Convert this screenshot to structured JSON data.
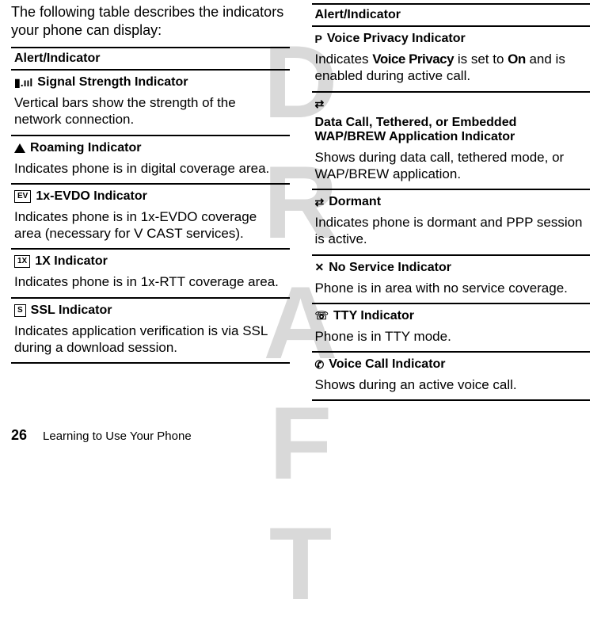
{
  "watermark": "DRAFT",
  "intro": "The following table describes the indicators your phone can display:",
  "header": "Alert/Indicator",
  "left_rows": [
    {
      "icon": "signal-bars-icon",
      "icon_text": "▮.ııl",
      "title": "Signal Strength Indicator",
      "desc": "Vertical bars show the strength of the network connection."
    },
    {
      "icon": "triangle-icon",
      "icon_text": "",
      "title": "Roaming Indicator",
      "desc": "Indicates phone is in digital coverage area."
    },
    {
      "icon": "ev-box-icon",
      "icon_text": "EV",
      "title": "1x-EVDO Indicator",
      "desc": "Indicates phone is in 1x-EVDO coverage area (necessary for V CAST services)."
    },
    {
      "icon": "1x-box-icon",
      "icon_text": "1X",
      "title": "1X Indicator",
      "desc": "Indicates phone is in 1x-RTT coverage area."
    },
    {
      "icon": "ssl-box-icon",
      "icon_text": "S",
      "title": "SSL Indicator",
      "desc_pre": "Indicates ",
      "desc_bold": "application verification is via SSL during a download session.",
      "desc_post": ""
    }
  ],
  "right_rows": [
    {
      "icon": "p-icon",
      "icon_text": "P",
      "title": "Voice Privacy Indicator",
      "desc_pre": "Indicates ",
      "cond1": "Voice Privacy",
      "mid1": " is set to ",
      "cond2": "On",
      "mid2": " and is enabled during active call."
    },
    {
      "icon": "data-arrows-icon",
      "icon_text": "⇄",
      "title": "Data Call, Tethered, or Embedded WAP/BREW Application Indicator",
      "desc": "Shows during data call, tethered mode, or WAP/BREW application."
    },
    {
      "icon": "dormant-icon",
      "icon_text": "⇄",
      "title": "Dormant",
      "desc_pre": "Indicates ",
      "desc_bold": "phone is dormant and PPP session is active.",
      "desc_post": ""
    },
    {
      "icon": "no-service-icon",
      "icon_text": "✕",
      "title": "No Service Indicator",
      "desc": "Phone is in area with no service coverage."
    },
    {
      "icon": "tty-icon",
      "icon_text": "☏",
      "title": "TTY Indicator",
      "desc": "Phone is in TTY mode."
    },
    {
      "icon": "voice-call-icon",
      "icon_text": "✆",
      "title": "Voice Call Indicator",
      "desc": "Shows during an active voice call."
    }
  ],
  "footer": {
    "page": "26",
    "text": "Learning to Use Your Phone"
  }
}
